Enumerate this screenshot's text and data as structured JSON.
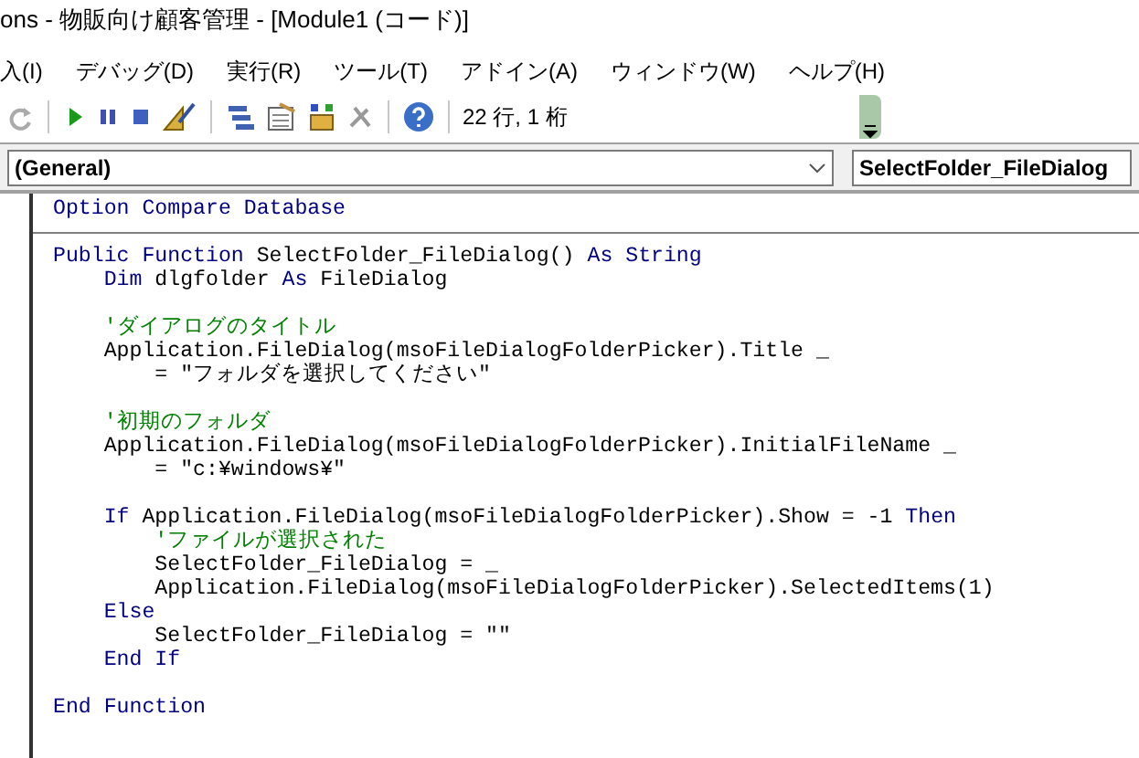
{
  "window": {
    "title": "ons - 物販向け顧客管理 - [Module1 (コード)]"
  },
  "menu": [
    "入(I)",
    "デバッグ(D)",
    "実行(R)",
    "ツール(T)",
    "アドイン(A)",
    "ウィンドウ(W)",
    "ヘルプ(H)"
  ],
  "toolbar": {
    "position": "22 行, 1 桁"
  },
  "object_combo": {
    "value": "(General)"
  },
  "procedure_combo": {
    "value": "SelectFolder_FileDialog"
  },
  "declarations": [
    {
      "kind": "code",
      "segments": [
        {
          "kind": "keyword",
          "text": "Option Compare Database"
        }
      ]
    }
  ],
  "code": [
    {
      "kind": "code",
      "segments": [
        {
          "kind": "keyword",
          "text": "Public Function "
        },
        {
          "kind": "plain",
          "text": "SelectFolder_FileDialog() "
        },
        {
          "kind": "keyword",
          "text": "As String"
        }
      ],
      "children": [
        {
          "kind": "code",
          "segments": [
            {
              "kind": "keyword",
              "text": "Dim "
            },
            {
              "kind": "plain",
              "text": "dlgfolder "
            },
            {
              "kind": "keyword",
              "text": "As "
            },
            {
              "kind": "plain",
              "text": "FileDialog"
            }
          ]
        },
        {
          "kind": "blank"
        },
        {
          "kind": "code",
          "segments": [
            {
              "kind": "comment",
              "text": "'ダイアログのタイトル"
            }
          ]
        },
        {
          "kind": "code",
          "segments": [
            {
              "kind": "plain",
              "text": "Application.FileDialog(msoFileDialogFolderPicker).Title _"
            }
          ],
          "children": [
            {
              "kind": "code",
              "segments": [
                {
                  "kind": "plain",
                  "text": "= \"フォルダを選択してください\""
                }
              ]
            }
          ]
        },
        {
          "kind": "blank"
        },
        {
          "kind": "code",
          "segments": [
            {
              "kind": "comment",
              "text": "'初期のフォルダ"
            }
          ]
        },
        {
          "kind": "code",
          "segments": [
            {
              "kind": "plain",
              "text": "Application.FileDialog(msoFileDialogFolderPicker).InitialFileName _"
            }
          ],
          "children": [
            {
              "kind": "code",
              "segments": [
                {
                  "kind": "plain",
                  "text": "= \"c:¥windows¥\""
                }
              ]
            }
          ]
        },
        {
          "kind": "blank"
        },
        {
          "kind": "code",
          "segments": [
            {
              "kind": "keyword",
              "text": "If "
            },
            {
              "kind": "plain",
              "text": "Application.FileDialog(msoFileDialogFolderPicker).Show = -1 "
            },
            {
              "kind": "keyword",
              "text": "Then"
            }
          ],
          "children": [
            {
              "kind": "code",
              "segments": [
                {
                  "kind": "comment",
                  "text": "'ファイルが選択された"
                }
              ]
            },
            {
              "kind": "code",
              "segments": [
                {
                  "kind": "plain",
                  "text": "SelectFolder_FileDialog = _"
                }
              ]
            },
            {
              "kind": "code",
              "segments": [
                {
                  "kind": "plain",
                  "text": "Application.FileDialog(msoFileDialogFolderPicker).SelectedItems(1)"
                }
              ]
            }
          ]
        },
        {
          "kind": "code",
          "segments": [
            {
              "kind": "keyword",
              "text": "Else"
            }
          ],
          "children": [
            {
              "kind": "code",
              "segments": [
                {
                  "kind": "plain",
                  "text": "SelectFolder_FileDialog = \"\""
                }
              ]
            }
          ]
        },
        {
          "kind": "code",
          "segments": [
            {
              "kind": "keyword",
              "text": "End If"
            }
          ]
        }
      ]
    },
    {
      "kind": "blank"
    },
    {
      "kind": "code",
      "segments": [
        {
          "kind": "keyword",
          "text": "End Function"
        }
      ]
    }
  ]
}
